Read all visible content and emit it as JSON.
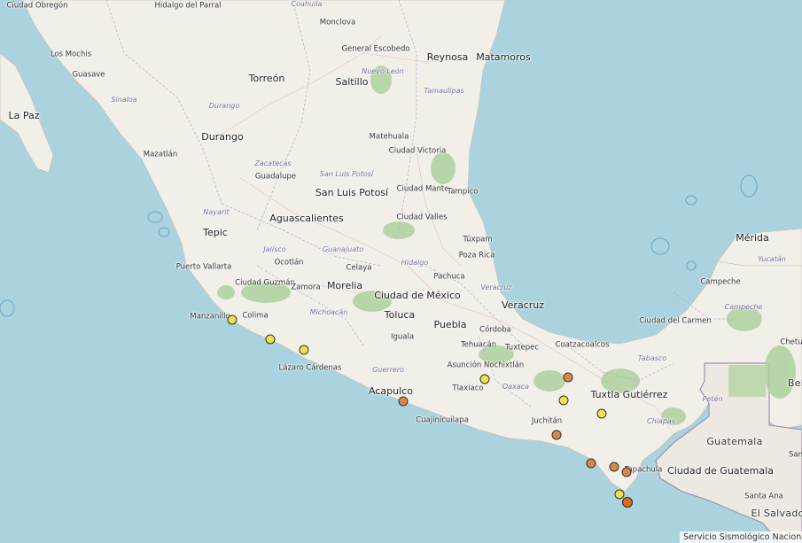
{
  "attribution": "Servicio Sismológico Nacional",
  "colors": {
    "ocean": "#aad3df",
    "land": "#f2efe9",
    "land_foreign": "#ede9e2",
    "forest": "#add19e",
    "border": "#9e8fb0",
    "marker_yellow": "#f1e14c",
    "marker_orange": "#d9864a",
    "marker_red": "#e06a1c"
  },
  "labels": [
    {
      "id": "ciudad-obregon",
      "text": "Ciudad Obregón",
      "kind": "city-s"
    },
    {
      "id": "hidalgo-del-parral",
      "text": "Hidalgo del Parral",
      "kind": "city-s"
    },
    {
      "id": "coahuila",
      "text": "Coahuila",
      "kind": "state"
    },
    {
      "id": "monclova",
      "text": "Monclova",
      "kind": "city-s"
    },
    {
      "id": "los-mochis",
      "text": "Los Mochis",
      "kind": "city-s"
    },
    {
      "id": "guasave",
      "text": "Guasave",
      "kind": "city-s"
    },
    {
      "id": "general-escobedo",
      "text": "General Escobedo",
      "kind": "city-s"
    },
    {
      "id": "nuevo-leon",
      "text": "Nuevo León",
      "kind": "state"
    },
    {
      "id": "reynosa",
      "text": "Reynosa",
      "kind": "city-l"
    },
    {
      "id": "matamoros",
      "text": "Matamoros",
      "kind": "city-l"
    },
    {
      "id": "torreon",
      "text": "Torreón",
      "kind": "city-l"
    },
    {
      "id": "saltillo",
      "text": "Saltillo",
      "kind": "city-l"
    },
    {
      "id": "tamaulipas",
      "text": "Tamaulipas",
      "kind": "state"
    },
    {
      "id": "sinaloa",
      "text": "Sinaloa",
      "kind": "state"
    },
    {
      "id": "la-paz",
      "text": "La Paz",
      "kind": "city-l"
    },
    {
      "id": "durango-state",
      "text": "Durango",
      "kind": "state"
    },
    {
      "id": "durango",
      "text": "Durango",
      "kind": "city-l"
    },
    {
      "id": "matehuala",
      "text": "Matehuala",
      "kind": "city-s"
    },
    {
      "id": "ciudad-victoria",
      "text": "Ciudad Victoria",
      "kind": "city-s"
    },
    {
      "id": "mazatlan",
      "text": "Mazatlán",
      "kind": "city-s"
    },
    {
      "id": "zacatecas-state",
      "text": "Zacatecas",
      "kind": "state"
    },
    {
      "id": "san-luis-potosi-state",
      "text": "San Luis Potosí",
      "kind": "state"
    },
    {
      "id": "guadalupe",
      "text": "Guadalupe",
      "kind": "city-s"
    },
    {
      "id": "ciudad-mante",
      "text": "Ciudad Mante",
      "kind": "city-s"
    },
    {
      "id": "tampico",
      "text": "Tampico",
      "kind": "city-s"
    },
    {
      "id": "san-luis-potosi",
      "text": "San Luis Potosí",
      "kind": "city-l"
    },
    {
      "id": "nayarit",
      "text": "Nayarit",
      "kind": "state"
    },
    {
      "id": "aguascalientes",
      "text": "Aguascalientes",
      "kind": "city-l"
    },
    {
      "id": "ciudad-valles",
      "text": "Ciudad Valles",
      "kind": "city-s"
    },
    {
      "id": "tepic",
      "text": "Tepic",
      "kind": "city-l"
    },
    {
      "id": "tuxpam",
      "text": "Túxpam",
      "kind": "city-s"
    },
    {
      "id": "merida",
      "text": "Mérida",
      "kind": "city-l"
    },
    {
      "id": "jalisco",
      "text": "Jalisco",
      "kind": "state"
    },
    {
      "id": "guanajuato",
      "text": "Guanajuato",
      "kind": "state"
    },
    {
      "id": "poza-rica",
      "text": "Poza Rica",
      "kind": "city-s"
    },
    {
      "id": "yucatan",
      "text": "Yucatán",
      "kind": "state"
    },
    {
      "id": "puerto-vallarta",
      "text": "Puerto Vallarta",
      "kind": "city-s"
    },
    {
      "id": "ocotlan",
      "text": "Ocotlán",
      "kind": "city-s"
    },
    {
      "id": "hidalgo",
      "text": "Hidalgo",
      "kind": "state"
    },
    {
      "id": "celaya",
      "text": "Celaya",
      "kind": "city-s"
    },
    {
      "id": "pachuca",
      "text": "Pachuca",
      "kind": "city-s"
    },
    {
      "id": "ciudad-guzman",
      "text": "Ciudad Guzmán",
      "kind": "city-s"
    },
    {
      "id": "zamora",
      "text": "Zamora",
      "kind": "city-s"
    },
    {
      "id": "morelia",
      "text": "Morelia",
      "kind": "city-l"
    },
    {
      "id": "ciudad-de-mexico",
      "text": "Ciudad de México",
      "kind": "city-l"
    },
    {
      "id": "veracruz-state",
      "text": "Veracruz",
      "kind": "state"
    },
    {
      "id": "campeche",
      "text": "Campeche",
      "kind": "city-s"
    },
    {
      "id": "campeche-state",
      "text": "Campeche",
      "kind": "state"
    },
    {
      "id": "manzanillo",
      "text": "Manzanillo",
      "kind": "city-s"
    },
    {
      "id": "colima",
      "text": "Colima",
      "kind": "city-s"
    },
    {
      "id": "michoacan",
      "text": "Michoacán",
      "kind": "state"
    },
    {
      "id": "toluca",
      "text": "Toluca",
      "kind": "city-l"
    },
    {
      "id": "veracruz",
      "text": "Veracruz",
      "kind": "city-l"
    },
    {
      "id": "puebla",
      "text": "Puebla",
      "kind": "city-l"
    },
    {
      "id": "ciudad-del-carmen",
      "text": "Ciudad del Carmen",
      "kind": "city-s"
    },
    {
      "id": "iguala",
      "text": "Iguala",
      "kind": "city-s"
    },
    {
      "id": "cordoba",
      "text": "Córdoba",
      "kind": "city-s"
    },
    {
      "id": "tehuacan",
      "text": "Tehuacán",
      "kind": "city-s"
    },
    {
      "id": "coatzacoalcos",
      "text": "Coatzacoalcos",
      "kind": "city-s"
    },
    {
      "id": "tuxtepec",
      "text": "Tuxtepec",
      "kind": "city-s"
    },
    {
      "id": "chetumal",
      "text": "Chetu",
      "kind": "city-s"
    },
    {
      "id": "lazaro-cardenas",
      "text": "Lázaro Cárdenas",
      "kind": "city-s"
    },
    {
      "id": "tabasco",
      "text": "Tabasco",
      "kind": "state"
    },
    {
      "id": "belize",
      "text": "Bel",
      "kind": "country"
    },
    {
      "id": "guerrero",
      "text": "Guerrero",
      "kind": "state"
    },
    {
      "id": "asuncion-nochixtlan",
      "text": "Asunción Nochixtlán",
      "kind": "city-s"
    },
    {
      "id": "oaxaca",
      "text": "Oaxaca",
      "kind": "state"
    },
    {
      "id": "tlaxiaco",
      "text": "Tlaxiaco",
      "kind": "city-s"
    },
    {
      "id": "tuxtla-gutierrez",
      "text": "Tuxtla Gutiérrez",
      "kind": "city-l"
    },
    {
      "id": "acapulco",
      "text": "Acapulco",
      "kind": "city-l"
    },
    {
      "id": "peten",
      "text": "Petén",
      "kind": "state"
    },
    {
      "id": "juchitan",
      "text": "Juchitán",
      "kind": "city-s"
    },
    {
      "id": "chiapas",
      "text": "Chiapas",
      "kind": "state"
    },
    {
      "id": "cuajinicuilapa",
      "text": "Cuajinicuilapa",
      "kind": "city-s"
    },
    {
      "id": "guatemala",
      "text": "Guatemala",
      "kind": "country"
    },
    {
      "id": "tapachula",
      "text": "Tapachula",
      "kind": "city-s"
    },
    {
      "id": "ciudad-de-guatemala",
      "text": "Ciudad de Guatemala",
      "kind": "city-l"
    },
    {
      "id": "san",
      "text": "San",
      "kind": "city-s"
    },
    {
      "id": "santa-ana",
      "text": "Santa Ana",
      "kind": "city-s"
    },
    {
      "id": "el-salvador",
      "text": "El Salvador",
      "kind": "country"
    }
  ],
  "markers": [
    {
      "color": "yellow"
    },
    {
      "color": "yellow"
    },
    {
      "color": "yellow"
    },
    {
      "color": "yellow"
    },
    {
      "color": "orange"
    },
    {
      "color": "orange"
    },
    {
      "color": "yellow"
    },
    {
      "color": "yellow"
    },
    {
      "color": "orange"
    },
    {
      "color": "orange"
    },
    {
      "color": "orange"
    },
    {
      "color": "orange"
    },
    {
      "color": "yellow"
    },
    {
      "color": "red"
    }
  ]
}
